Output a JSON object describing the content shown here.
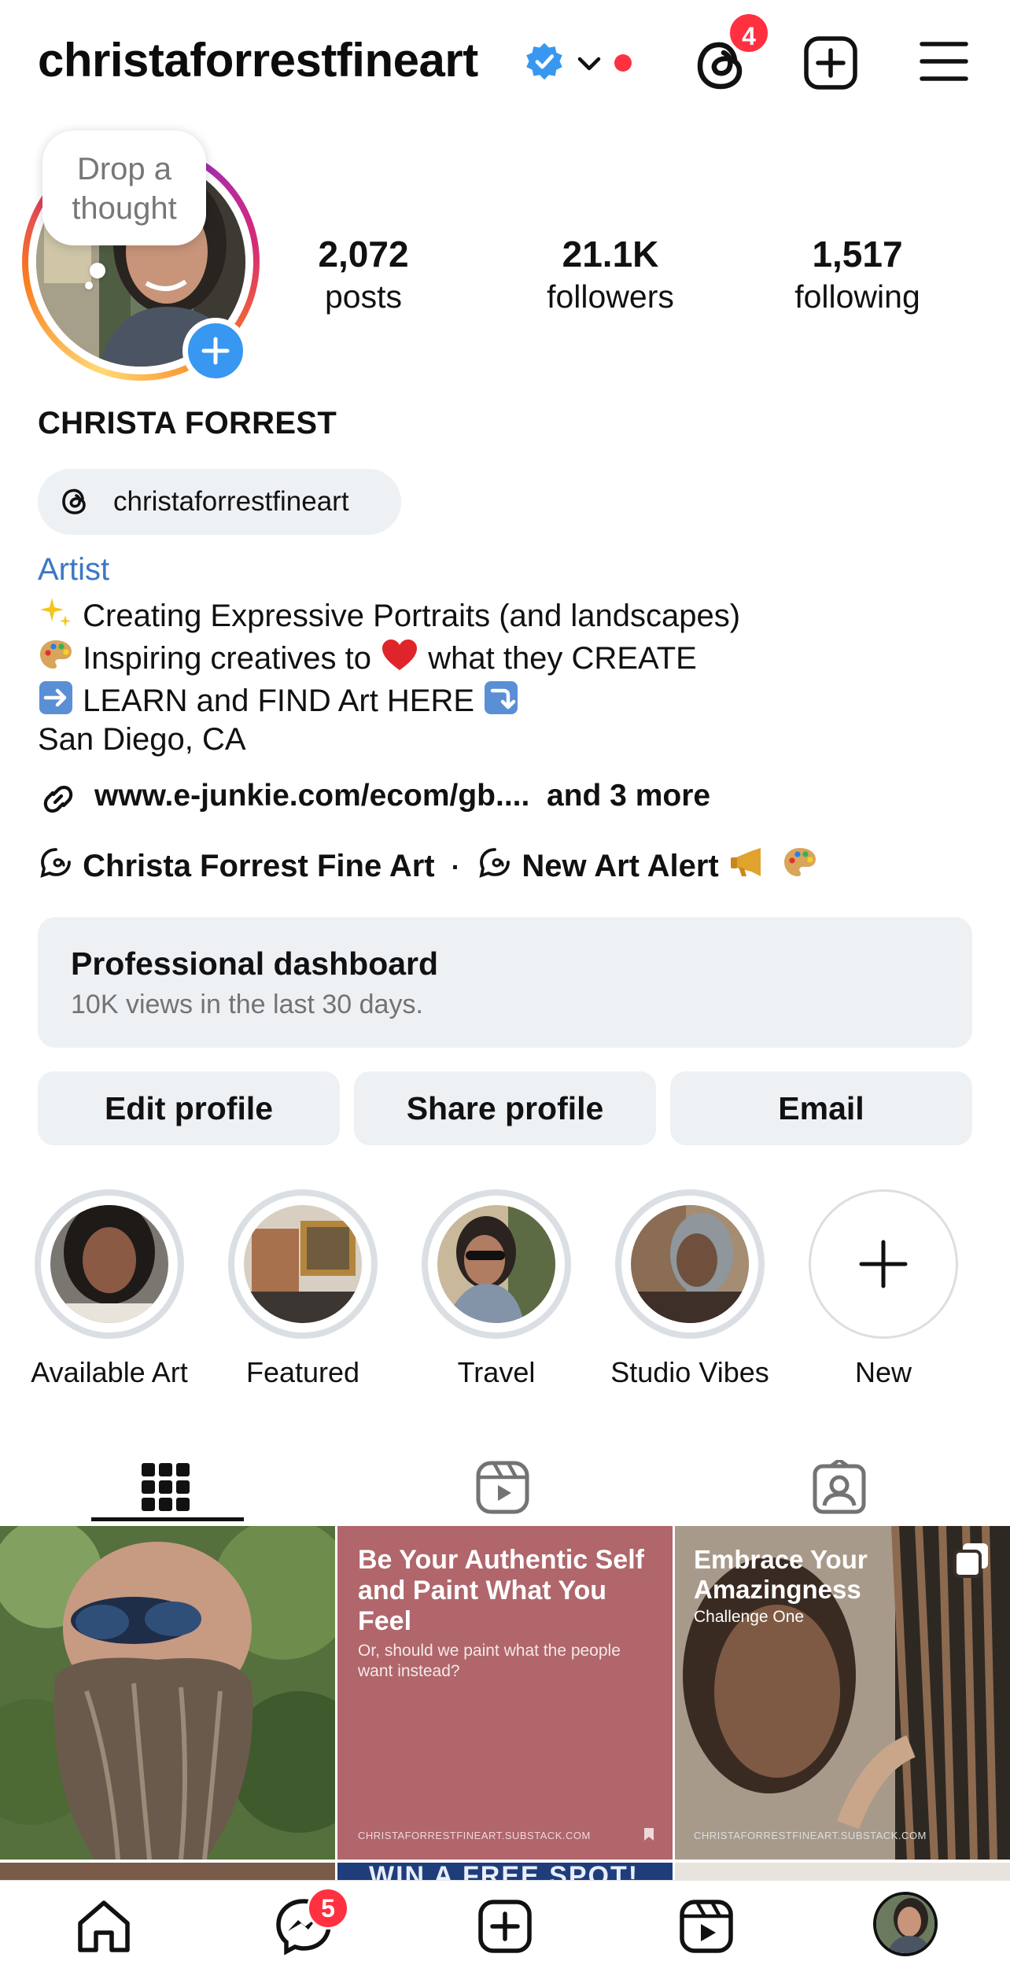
{
  "header": {
    "username": "christaforrestfineart",
    "threads_badge": "4",
    "icons": [
      "verified-badge-icon",
      "chevron-down-icon",
      "threads-icon",
      "create-icon",
      "menu-icon"
    ]
  },
  "profile": {
    "note_bubble": "Drop a thought",
    "stats": [
      {
        "value": "2,072",
        "label": "posts"
      },
      {
        "value": "21.1K",
        "label": "followers"
      },
      {
        "value": "1,517",
        "label": "following"
      }
    ],
    "full_name": "CHRISTA FORREST",
    "threads_handle": "christaforrestfineart",
    "category": "Artist",
    "bio": {
      "line1": "Creating Expressive Portraits (and landscapes)",
      "line2_a": "Inspiring creatives to",
      "line2_b": "what they CREATE",
      "line3": "LEARN and FIND Art HERE",
      "line4": "San Diego, CA"
    },
    "link": {
      "url": "www.e-junkie.com/ecom/gb....",
      "more": "and 3 more"
    },
    "threads_links": [
      "Christa Forrest Fine Art",
      "·",
      "New Art Alert"
    ]
  },
  "dashboard": {
    "title": "Professional dashboard",
    "subtitle": "10K views in the last 30 days."
  },
  "buttons": {
    "edit": "Edit profile",
    "share": "Share profile",
    "email": "Email"
  },
  "highlights": [
    {
      "label": "Available Art"
    },
    {
      "label": "Featured"
    },
    {
      "label": "Travel"
    },
    {
      "label": "Studio Vibes"
    },
    {
      "label": "New"
    }
  ],
  "posts": [
    {
      "kind": "painting"
    },
    {
      "title": "Be Your Authentic Self and Paint What You Feel",
      "subtitle": "Or, should we paint what the people want instead?",
      "footer": "CHRISTAFORRESTFINEART.SUBSTACK.COM",
      "bg": "#b0666b"
    },
    {
      "title": "Embrace Your Amazingness",
      "subtitle": "Challenge One",
      "footer": "CHRISTAFORRESTFINEART.SUBSTACK.COM"
    }
  ],
  "row2_text": "WIN A FREE SPOT!",
  "navbar": {
    "messages_badge": "5",
    "icons": [
      "home-icon",
      "messenger-icon",
      "create-icon",
      "reels-icon",
      "profile-avatar"
    ]
  },
  "colors": {
    "accent": "#3897f0",
    "badge": "#ff3040",
    "link_blue": "#3b78c4",
    "chip_bg": "#eef1f4"
  }
}
